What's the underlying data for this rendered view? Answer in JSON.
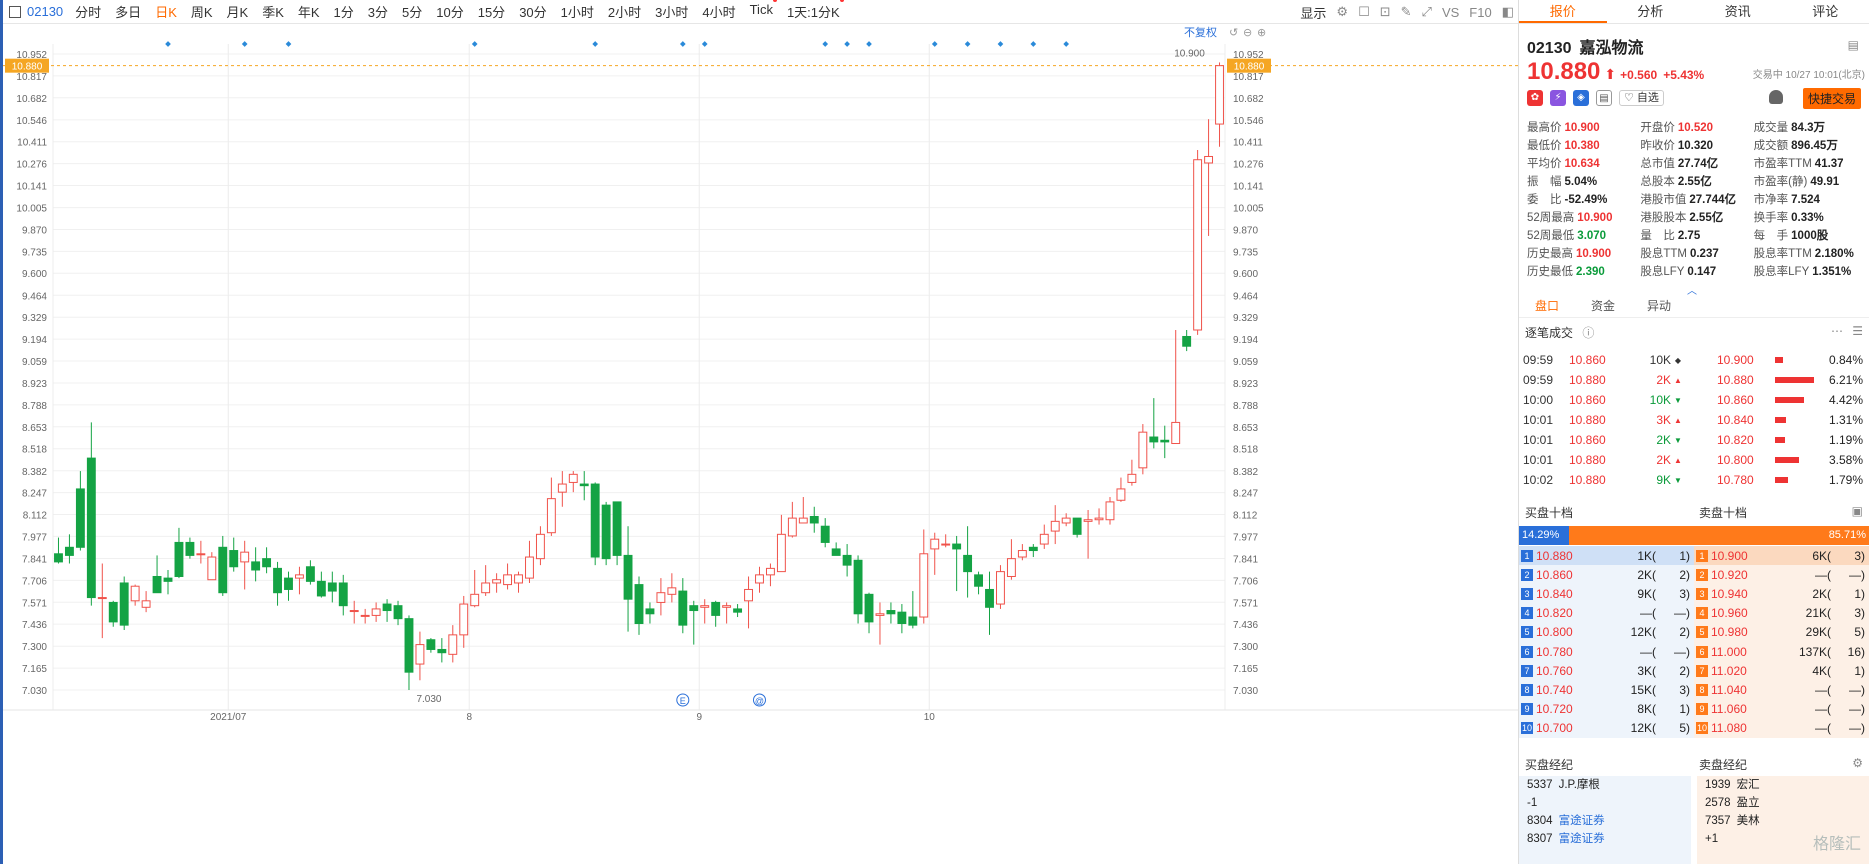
{
  "toolbar": {
    "code": "02130",
    "periods": [
      "分时",
      "多日",
      "日K",
      "周K",
      "月K",
      "季K",
      "年K",
      "1分",
      "3分",
      "5分",
      "10分",
      "15分",
      "30分",
      "1小时",
      "2小时",
      "3小时",
      "4小时",
      "Tick",
      "1天:1分K"
    ],
    "active_period": "日K",
    "display_label": "显示",
    "right_labels": [
      "VS",
      "F10"
    ]
  },
  "chart": {
    "no_adjust_label": "不复权",
    "last_price_label": "10.880",
    "high_marker": "10.900",
    "low_marker": "7.030",
    "event_marks": [
      "E",
      "@"
    ],
    "up_color": "#f0524a",
    "down_color": "#14a344"
  },
  "chart_data": {
    "type": "candlestick",
    "y_ticks": [
      10.952,
      10.817,
      10.682,
      10.546,
      10.411,
      10.276,
      10.141,
      10.005,
      9.87,
      9.735,
      9.6,
      9.464,
      9.329,
      9.194,
      9.059,
      8.923,
      8.788,
      8.653,
      8.518,
      8.382,
      8.247,
      8.112,
      7.977,
      7.841,
      7.706,
      7.571,
      7.436,
      7.3,
      7.165,
      7.03
    ],
    "x_labels": [
      "2021/07",
      "8",
      "9",
      "10"
    ],
    "reference_line": 10.88,
    "candles": [
      [
        7.87,
        7.82,
        7.97,
        7.81
      ],
      [
        7.91,
        7.86,
        7.99,
        7.81
      ],
      [
        8.27,
        7.91,
        8.38,
        7.89
      ],
      [
        8.46,
        7.6,
        8.68,
        7.55
      ],
      [
        7.6,
        7.6,
        7.81,
        7.35
      ],
      [
        7.57,
        7.45,
        7.58,
        7.42
      ],
      [
        7.69,
        7.43,
        7.73,
        7.4
      ],
      [
        7.58,
        7.67,
        7.68,
        7.55
      ],
      [
        7.54,
        7.58,
        7.64,
        7.51
      ],
      [
        7.73,
        7.63,
        7.86,
        7.63
      ],
      [
        7.72,
        7.7,
        7.77,
        7.62
      ],
      [
        7.94,
        7.73,
        8.03,
        7.72
      ],
      [
        7.94,
        7.86,
        7.97,
        7.84
      ],
      [
        7.87,
        7.87,
        7.95,
        7.81
      ],
      [
        7.71,
        7.85,
        7.88,
        7.71
      ],
      [
        7.91,
        7.63,
        7.98,
        7.61
      ],
      [
        7.89,
        7.79,
        7.97,
        7.76
      ],
      [
        7.82,
        7.88,
        7.95,
        7.65
      ],
      [
        7.82,
        7.77,
        7.91,
        7.7
      ],
      [
        7.84,
        7.79,
        7.91,
        7.75
      ],
      [
        7.78,
        7.63,
        7.82,
        7.55
      ],
      [
        7.72,
        7.65,
        7.76,
        7.58
      ],
      [
        7.72,
        7.74,
        7.79,
        7.62
      ],
      [
        7.79,
        7.7,
        7.83,
        7.68
      ],
      [
        7.7,
        7.61,
        7.76,
        7.6
      ],
      [
        7.69,
        7.64,
        7.76,
        7.57
      ],
      [
        7.69,
        7.55,
        7.74,
        7.49
      ],
      [
        7.52,
        7.52,
        7.58,
        7.44
      ],
      [
        7.49,
        7.49,
        7.53,
        7.44
      ],
      [
        7.49,
        7.53,
        7.57,
        7.45
      ],
      [
        7.56,
        7.52,
        7.59,
        7.45
      ],
      [
        7.55,
        7.47,
        7.58,
        7.43
      ],
      [
        7.47,
        7.14,
        7.49,
        7.03
      ],
      [
        7.19,
        7.31,
        7.39,
        7.09
      ],
      [
        7.34,
        7.28,
        7.35,
        7.26
      ],
      [
        7.28,
        7.26,
        7.35,
        7.2
      ],
      [
        7.25,
        7.37,
        7.43,
        7.2
      ],
      [
        7.37,
        7.56,
        7.61,
        7.29
      ],
      [
        7.55,
        7.62,
        7.77,
        7.54
      ],
      [
        7.63,
        7.69,
        7.8,
        7.61
      ],
      [
        7.69,
        7.71,
        7.75,
        7.63
      ],
      [
        7.68,
        7.74,
        7.81,
        7.65
      ],
      [
        7.69,
        7.74,
        7.76,
        7.63
      ],
      [
        7.72,
        7.85,
        7.95,
        7.69
      ],
      [
        7.84,
        7.99,
        8.04,
        7.8
      ],
      [
        8.0,
        8.21,
        8.34,
        7.98
      ],
      [
        8.25,
        8.3,
        8.38,
        8.16
      ],
      [
        8.31,
        8.36,
        8.38,
        8.25
      ],
      [
        8.3,
        8.29,
        8.38,
        8.2
      ],
      [
        8.3,
        7.85,
        8.31,
        7.8
      ],
      [
        8.17,
        7.84,
        8.19,
        7.8
      ],
      [
        8.19,
        7.86,
        8.19,
        7.8
      ],
      [
        7.86,
        7.59,
        8.04,
        7.39
      ],
      [
        7.68,
        7.44,
        7.73,
        7.37
      ],
      [
        7.53,
        7.5,
        7.57,
        7.44
      ],
      [
        7.57,
        7.63,
        7.72,
        7.49
      ],
      [
        7.62,
        7.66,
        7.75,
        7.57
      ],
      [
        7.64,
        7.43,
        7.72,
        7.38
      ],
      [
        7.55,
        7.52,
        7.58,
        7.31
      ],
      [
        7.54,
        7.55,
        7.59,
        7.44
      ],
      [
        7.57,
        7.49,
        7.58,
        7.42
      ],
      [
        7.54,
        7.55,
        7.57,
        7.44
      ],
      [
        7.53,
        7.51,
        7.56,
        7.48
      ],
      [
        7.58,
        7.65,
        7.73,
        7.41
      ],
      [
        7.69,
        7.74,
        7.79,
        7.63
      ],
      [
        7.74,
        7.78,
        7.81,
        7.67
      ],
      [
        7.76,
        7.99,
        8.11,
        7.76
      ],
      [
        7.98,
        8.09,
        8.19,
        7.97
      ],
      [
        8.06,
        8.09,
        8.22,
        8.06
      ],
      [
        8.1,
        8.06,
        8.16,
        8.0
      ],
      [
        8.04,
        7.94,
        8.09,
        7.91
      ],
      [
        7.9,
        7.86,
        7.94,
        7.86
      ],
      [
        7.86,
        7.8,
        7.93,
        7.73
      ],
      [
        7.83,
        7.5,
        7.86,
        7.44
      ],
      [
        7.62,
        7.45,
        7.63,
        7.38
      ],
      [
        7.49,
        7.5,
        7.57,
        7.31
      ],
      [
        7.52,
        7.5,
        7.57,
        7.44
      ],
      [
        7.51,
        7.44,
        7.56,
        7.38
      ],
      [
        7.48,
        7.43,
        7.64,
        7.41
      ],
      [
        7.48,
        7.87,
        8.02,
        7.44
      ],
      [
        7.9,
        7.96,
        8.0,
        7.74
      ],
      [
        7.93,
        7.93,
        7.99,
        7.91
      ],
      [
        7.93,
        7.9,
        7.98,
        7.64
      ],
      [
        7.86,
        7.76,
        8.04,
        7.6
      ],
      [
        7.74,
        7.67,
        7.76,
        7.62
      ],
      [
        7.65,
        7.54,
        7.76,
        7.37
      ],
      [
        7.56,
        7.76,
        7.8,
        7.53
      ],
      [
        7.73,
        7.84,
        7.96,
        7.71
      ],
      [
        7.85,
        7.89,
        7.93,
        7.83
      ],
      [
        7.91,
        7.89,
        7.93,
        7.85
      ],
      [
        7.93,
        7.99,
        8.05,
        7.9
      ],
      [
        8.01,
        8.07,
        8.17,
        7.93
      ],
      [
        8.06,
        8.09,
        8.12,
        8.04
      ],
      [
        8.09,
        7.99,
        8.09,
        7.97
      ],
      [
        8.07,
        8.08,
        8.14,
        7.84
      ],
      [
        8.08,
        8.09,
        8.15,
        8.05
      ],
      [
        8.08,
        8.19,
        8.22,
        8.05
      ],
      [
        8.2,
        8.27,
        8.34,
        8.19
      ],
      [
        8.31,
        8.36,
        8.45,
        8.29
      ],
      [
        8.4,
        8.62,
        8.67,
        8.36
      ],
      [
        8.59,
        8.56,
        8.83,
        8.52
      ],
      [
        8.57,
        8.56,
        8.66,
        8.46
      ],
      [
        8.55,
        8.68,
        9.25,
        8.64
      ],
      [
        9.21,
        9.15,
        9.25,
        9.12
      ],
      [
        9.25,
        10.3,
        10.36,
        9.22
      ],
      [
        10.28,
        10.32,
        10.55,
        9.83
      ],
      [
        10.52,
        10.88,
        10.9,
        10.38
      ]
    ]
  },
  "quote": {
    "code": "02130",
    "name": "嘉泓物流",
    "price": "10.880",
    "arrow": "⬆",
    "change": "+0.560",
    "change_pct": "+5.43%",
    "status": "交易中 10/27 10:01(北京)",
    "watch_label": "自选",
    "quick_trade_label": "快捷交易"
  },
  "panel_tabs": [
    "报价",
    "分析",
    "资讯",
    "评论"
  ],
  "stats": [
    [
      {
        "l": "最高价",
        "v": "10.900",
        "c": "red"
      },
      {
        "l": "开盘价",
        "v": "10.520",
        "c": "red"
      },
      {
        "l": "成交量",
        "v": "84.3万",
        "c": ""
      }
    ],
    [
      {
        "l": "最低价",
        "v": "10.380",
        "c": "red"
      },
      {
        "l": "昨收价",
        "v": "10.320",
        "c": ""
      },
      {
        "l": "成交额",
        "v": "896.45万",
        "c": ""
      }
    ],
    [
      {
        "l": "平均价",
        "v": "10.634",
        "c": "red"
      },
      {
        "l": "总市值",
        "v": "27.74亿",
        "c": ""
      },
      {
        "l": "市盈率TTM",
        "v": "41.37",
        "c": ""
      }
    ],
    [
      {
        "l": "振　幅",
        "v": "5.04%",
        "c": ""
      },
      {
        "l": "总股本",
        "v": "2.55亿",
        "c": ""
      },
      {
        "l": "市盈率(静)",
        "v": "49.91",
        "c": ""
      }
    ],
    [
      {
        "l": "委　比",
        "v": "-52.49%",
        "c": ""
      },
      {
        "l": "港股市值",
        "v": "27.744亿",
        "c": ""
      },
      {
        "l": "市净率",
        "v": "7.524",
        "c": ""
      }
    ],
    [
      {
        "l": "52周最高",
        "v": "10.900",
        "c": "red"
      },
      {
        "l": "港股股本",
        "v": "2.55亿",
        "c": ""
      },
      {
        "l": "换手率",
        "v": "0.33%",
        "c": ""
      }
    ],
    [
      {
        "l": "52周最低",
        "v": "3.070",
        "c": "green"
      },
      {
        "l": "量　比",
        "v": "2.75",
        "c": ""
      },
      {
        "l": "每　手",
        "v": "1000股",
        "c": ""
      }
    ],
    [
      {
        "l": "历史最高",
        "v": "10.900",
        "c": "red"
      },
      {
        "l": "股息TTM",
        "v": "0.237",
        "c": ""
      },
      {
        "l": "股息率TTM",
        "v": "2.180%",
        "c": ""
      }
    ],
    [
      {
        "l": "历史最低",
        "v": "2.390",
        "c": "green"
      },
      {
        "l": "股息LFY",
        "v": "0.147",
        "c": ""
      },
      {
        "l": "股息率LFY",
        "v": "1.351%",
        "c": ""
      }
    ]
  ],
  "subtabs": [
    "盘口",
    "资金",
    "异动"
  ],
  "trades_title": "逐笔成交",
  "trades": [
    {
      "t": "09:59",
      "p": "10.860",
      "v": "10K",
      "d": "◆",
      "c": ""
    },
    {
      "t": "09:59",
      "p": "10.880",
      "v": "2K",
      "d": "▲",
      "c": "red"
    },
    {
      "t": "10:00",
      "p": "10.860",
      "v": "10K",
      "d": "▼",
      "c": "green"
    },
    {
      "t": "10:01",
      "p": "10.880",
      "v": "3K",
      "d": "▲",
      "c": "red"
    },
    {
      "t": "10:01",
      "p": "10.860",
      "v": "2K",
      "d": "▼",
      "c": "green"
    },
    {
      "t": "10:01",
      "p": "10.880",
      "v": "2K",
      "d": "▲",
      "c": "red"
    },
    {
      "t": "10:02",
      "p": "10.880",
      "v": "9K",
      "d": "▼",
      "c": "green"
    }
  ],
  "price_dist": [
    {
      "p": "10.900",
      "pct": "0.84%",
      "w": 0.14
    },
    {
      "p": "10.880",
      "pct": "6.21%",
      "w": 1.0
    },
    {
      "p": "10.860",
      "pct": "4.42%",
      "w": 0.71
    },
    {
      "p": "10.840",
      "pct": "1.31%",
      "w": 0.21
    },
    {
      "p": "10.820",
      "pct": "1.19%",
      "w": 0.19
    },
    {
      "p": "10.800",
      "pct": "3.58%",
      "w": 0.58
    },
    {
      "p": "10.780",
      "pct": "1.79%",
      "w": 0.29
    }
  ],
  "orderbook": {
    "bid_title": "买盘十档",
    "ask_title": "卖盘十档",
    "bid_ratio": "14.29%",
    "ask_ratio": "85.71%",
    "bid_ratio_value": 0.1429,
    "levels": [
      {
        "n": "1",
        "bp": "10.880",
        "bq": "1K(",
        "bc": "1)",
        "ap": "10.900",
        "aq": "6K(",
        "ac": "3)"
      },
      {
        "n": "2",
        "bp": "10.860",
        "bq": "2K(",
        "bc": "2)",
        "ap": "10.920",
        "aq": "—(",
        "ac": "—)"
      },
      {
        "n": "3",
        "bp": "10.840",
        "bq": "9K(",
        "bc": "3)",
        "ap": "10.940",
        "aq": "2K(",
        "ac": "1)"
      },
      {
        "n": "4",
        "bp": "10.820",
        "bq": "—(",
        "bc": "—)",
        "ap": "10.960",
        "aq": "21K(",
        "ac": "3)"
      },
      {
        "n": "5",
        "bp": "10.800",
        "bq": "12K(",
        "bc": "2)",
        "ap": "10.980",
        "aq": "29K(",
        "ac": "5)"
      },
      {
        "n": "6",
        "bp": "10.780",
        "bq": "—(",
        "bc": "—)",
        "ap": "11.000",
        "aq": "137K(",
        "ac": "16)"
      },
      {
        "n": "7",
        "bp": "10.760",
        "bq": "3K(",
        "bc": "2)",
        "ap": "11.020",
        "aq": "4K(",
        "ac": "1)"
      },
      {
        "n": "8",
        "bp": "10.740",
        "bq": "15K(",
        "bc": "3)",
        "ap": "11.040",
        "aq": "—(",
        "ac": "—)"
      },
      {
        "n": "9",
        "bp": "10.720",
        "bq": "8K(",
        "bc": "1)",
        "ap": "11.060",
        "aq": "—(",
        "ac": "—)"
      },
      {
        "n": "10",
        "bp": "10.700",
        "bq": "12K(",
        "bc": "5)",
        "ap": "11.080",
        "aq": "—(",
        "ac": "—)"
      }
    ]
  },
  "brokers": {
    "bid_title": "买盘经纪",
    "ask_title": "卖盘经纪",
    "bid": [
      {
        "id": "5337",
        "name": "J.P.摩根"
      },
      {
        "id": "-1",
        "name": ""
      },
      {
        "id": "8304",
        "name": "富途证券"
      },
      {
        "id": "8307",
        "name": "富途证券"
      }
    ],
    "ask": [
      {
        "id": "1939",
        "name": "宏汇"
      },
      {
        "id": "2578",
        "name": "盈立"
      },
      {
        "id": "7357",
        "name": "美林"
      },
      {
        "id": "+1",
        "name": ""
      }
    ]
  },
  "watermark": "格隆汇"
}
